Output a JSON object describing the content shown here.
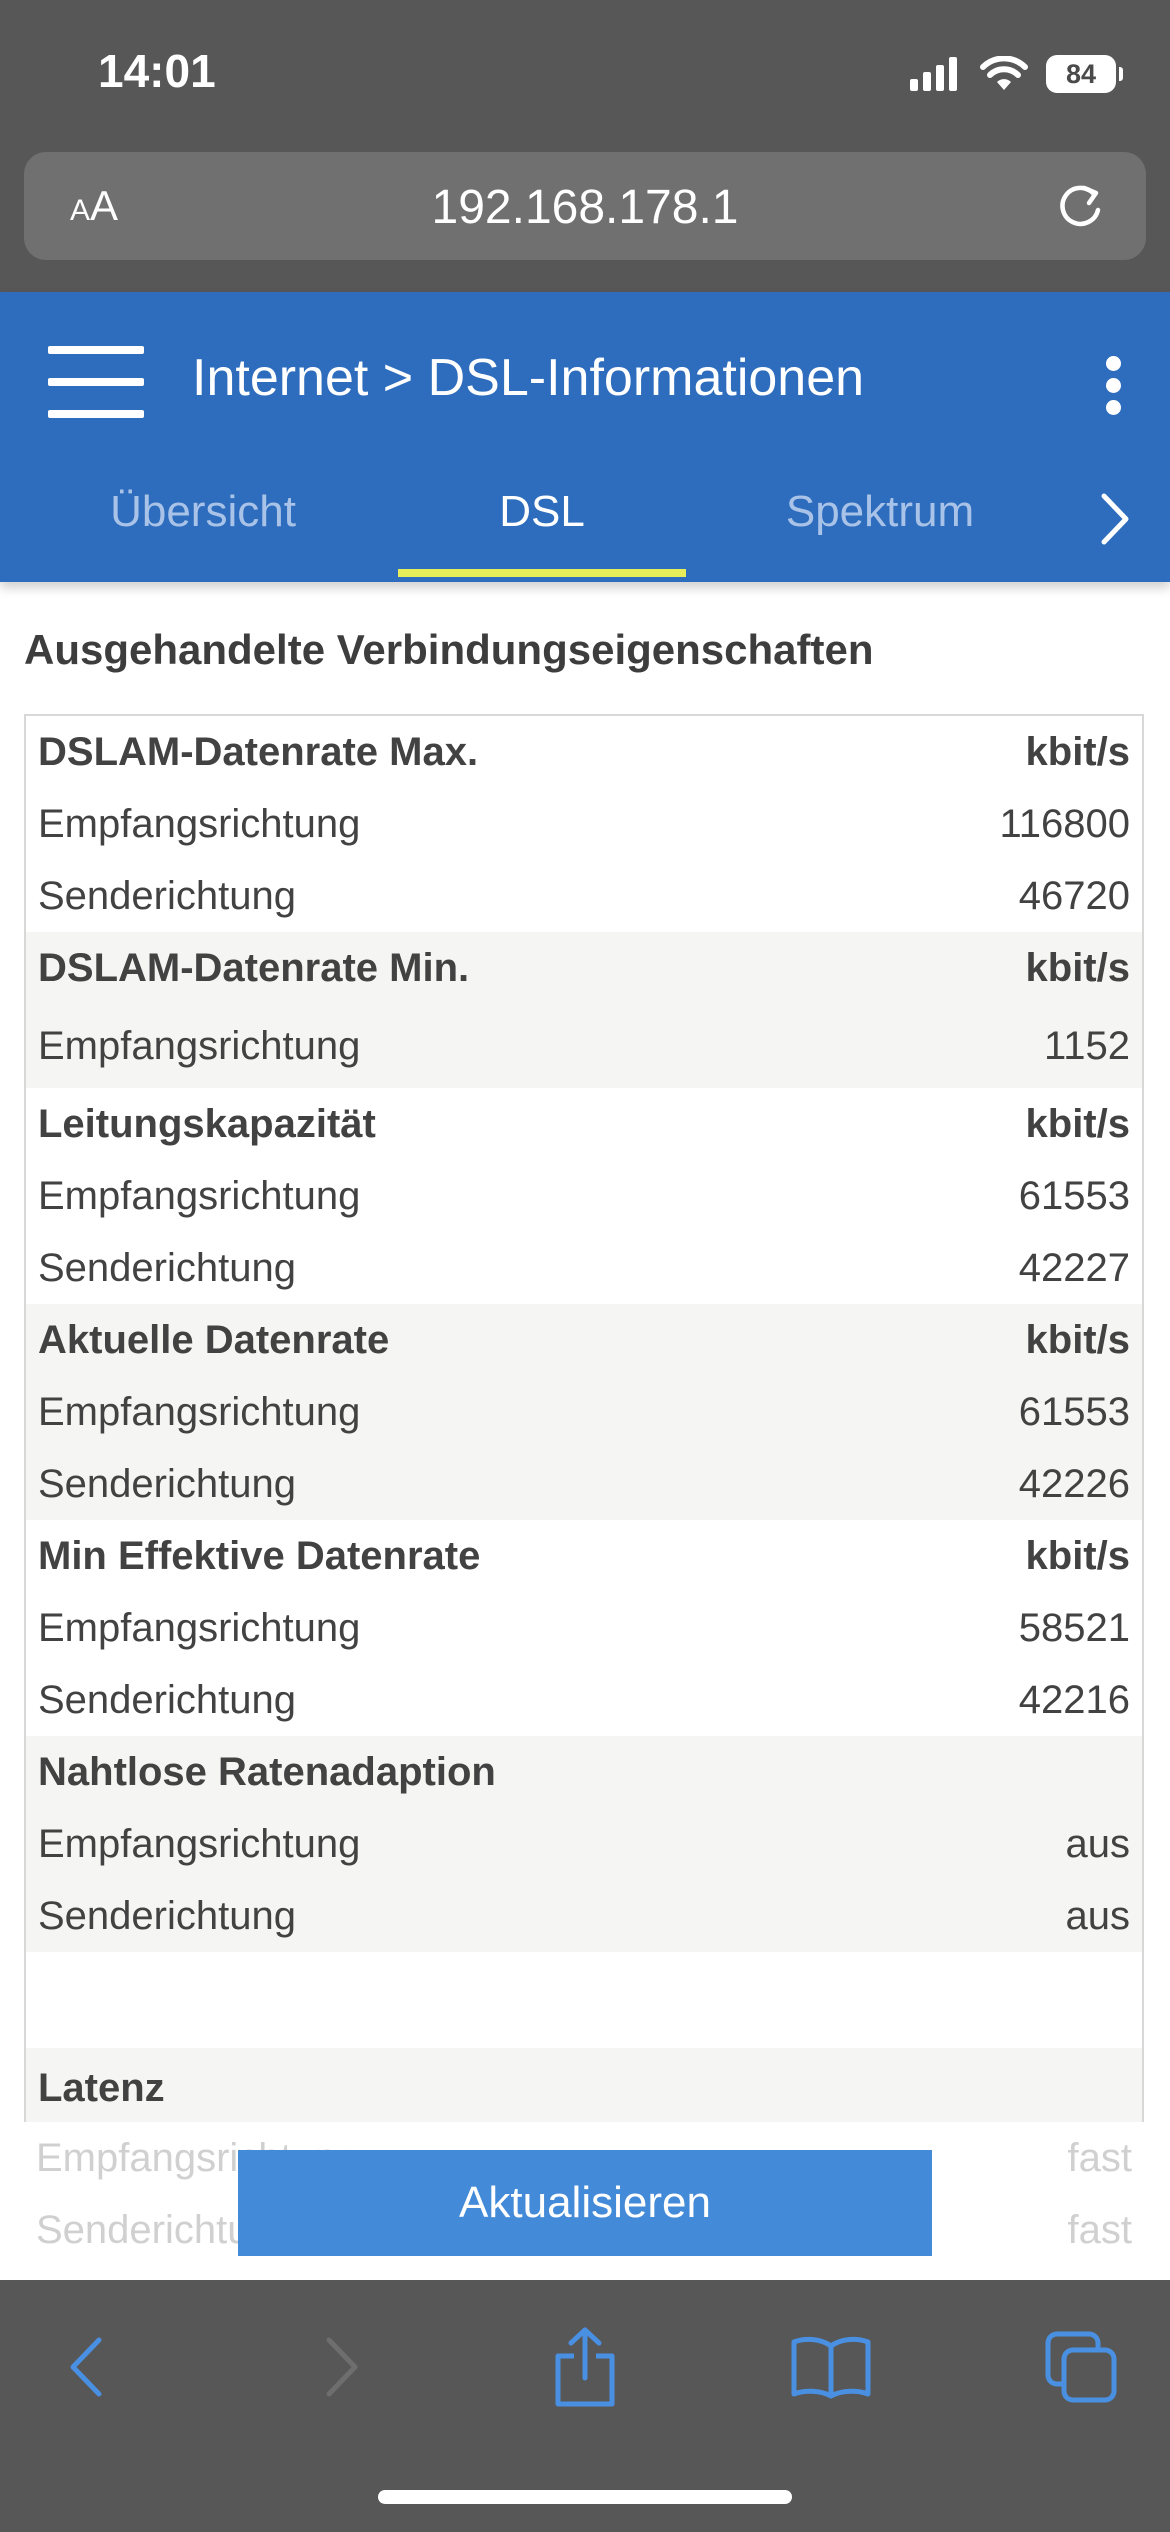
{
  "status_bar": {
    "time": "14:01",
    "battery": "84"
  },
  "browser": {
    "aa_label_small": "A",
    "aa_label_big": "A",
    "url": "192.168.178.1"
  },
  "header": {
    "breadcrumb_parent": "Internet",
    "breadcrumb_separator": ">",
    "breadcrumb_current": "DSL-Informationen",
    "tabs": [
      {
        "label": "Übersicht",
        "active": false
      },
      {
        "label": "DSL",
        "active": true
      },
      {
        "label": "Spektrum",
        "active": false
      }
    ],
    "accent_color": "#2e6dbd",
    "tab_indicator_color": "#e6ec5a"
  },
  "section": {
    "title": "Ausgehandelte Verbindungseigenschaften"
  },
  "table": {
    "rows": [
      {
        "label": "DSLAM-Datenrate Max.",
        "value": "kbit/s"
      },
      {
        "label": "Empfangsrichtung",
        "value": "116800"
      },
      {
        "label": "Senderichtung",
        "value": "46720"
      },
      {
        "label": "DSLAM-Datenrate Min.",
        "value": "kbit/s"
      },
      {
        "label": "Empfangsrichtung",
        "value": "1152"
      },
      {
        "label": "Leitungskapazität",
        "value": "kbit/s"
      },
      {
        "label": "Empfangsrichtung",
        "value": "61553"
      },
      {
        "label": "Senderichtung",
        "value": "42227"
      },
      {
        "label": "Aktuelle Datenrate",
        "value": "kbit/s"
      },
      {
        "label": "Empfangsrichtung",
        "value": "61553"
      },
      {
        "label": "Senderichtung",
        "value": "42226"
      },
      {
        "label": "Min Effektive Datenrate",
        "value": "kbit/s"
      },
      {
        "label": "Empfangsrichtung",
        "value": "58521"
      },
      {
        "label": "Senderichtung",
        "value": "42216"
      },
      {
        "label": "Nahtlose Ratenadaption",
        "value": ""
      },
      {
        "label": "Empfangsrichtung",
        "value": "aus"
      },
      {
        "label": "Senderichtung",
        "value": "aus"
      },
      {
        "label": "Latenz",
        "value": ""
      },
      {
        "label": "Empfangsrichtung",
        "value": "fast"
      },
      {
        "label": "Senderichtung",
        "value": "fast"
      }
    ]
  },
  "actions": {
    "update_label": "Aktualisieren"
  },
  "toolbar": {
    "icons": [
      "back-icon",
      "forward-icon",
      "share-icon",
      "bookmarks-icon",
      "tabs-icon"
    ]
  }
}
